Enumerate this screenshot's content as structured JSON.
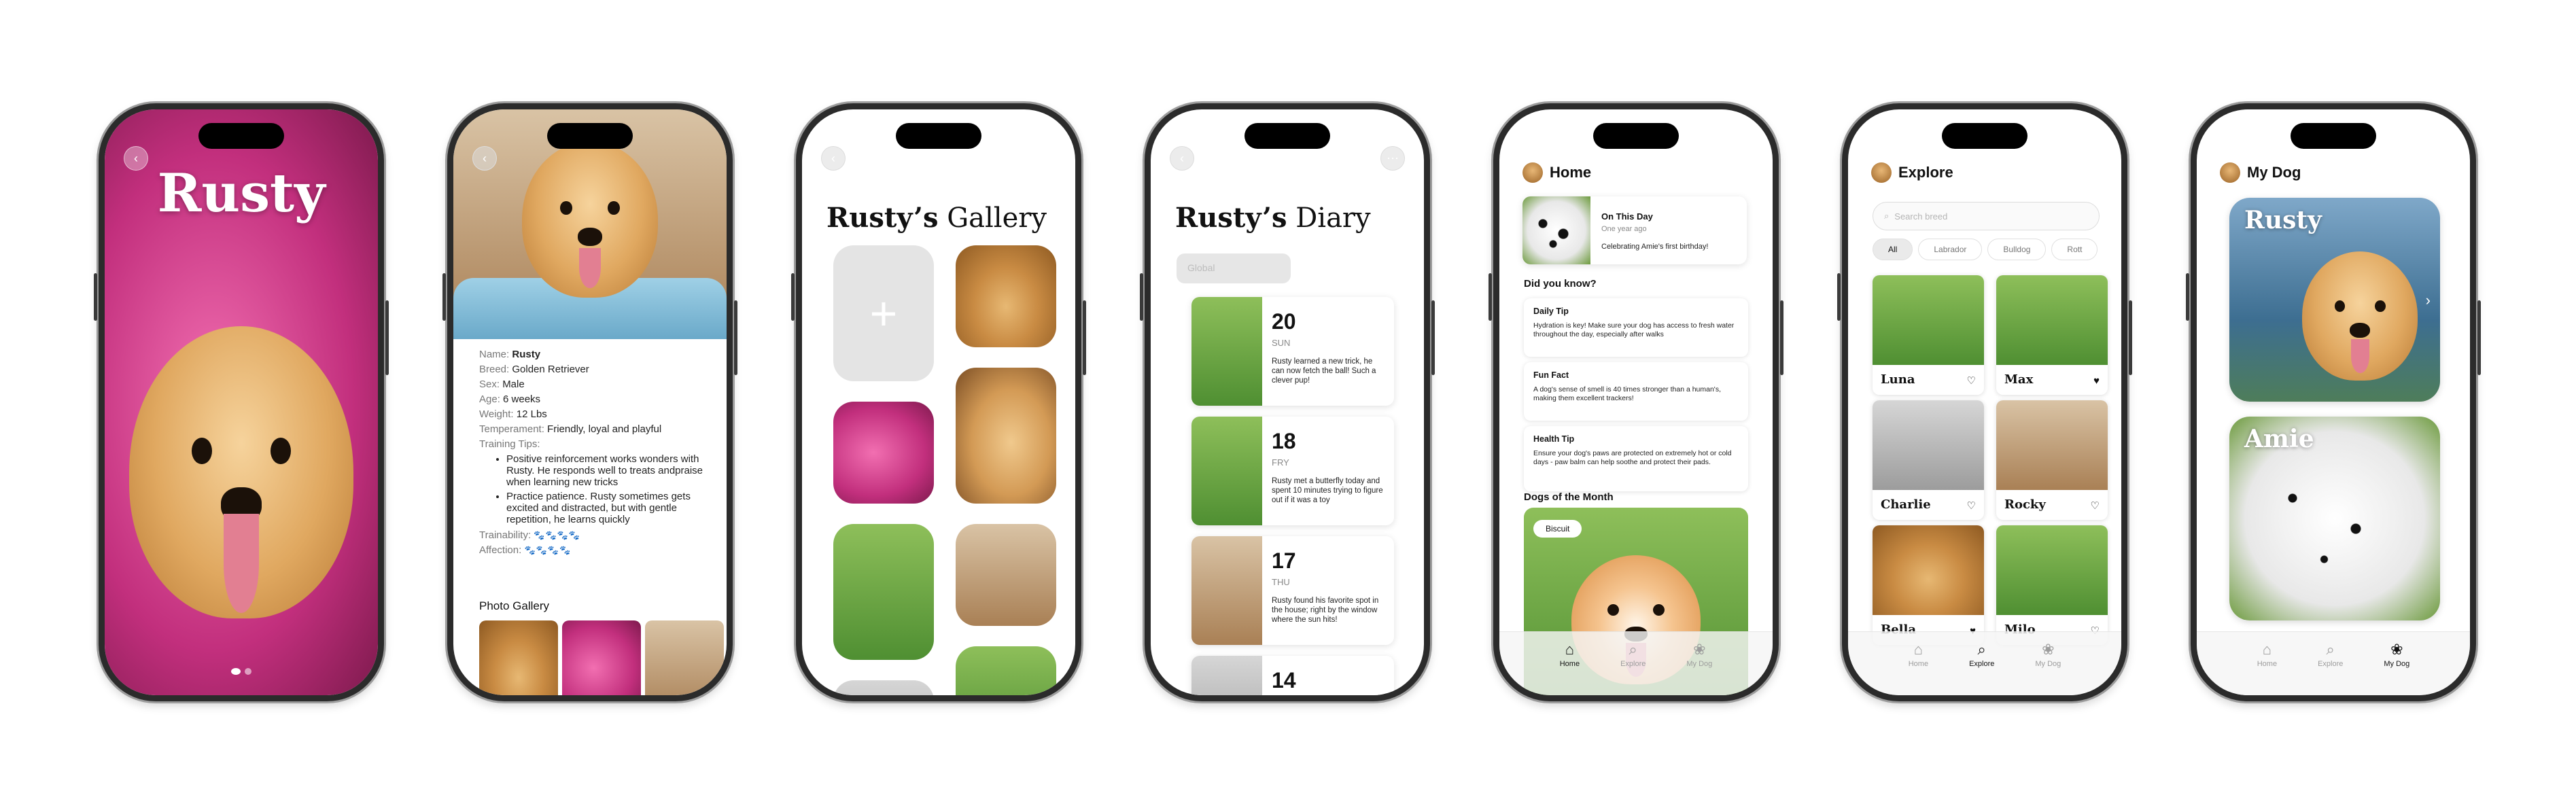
{
  "phone1": {
    "title": "Rusty",
    "back_icon": "chevron-left-icon",
    "page_dots": 2
  },
  "phone2": {
    "details": [
      {
        "key": "Name:",
        "value": "Rusty",
        "bold": true
      },
      {
        "key": "Breed:",
        "value": "Golden Retriever"
      },
      {
        "key": "Sex:",
        "value": "Male"
      },
      {
        "key": "Age:",
        "value": "6 weeks"
      },
      {
        "key": "Weight:",
        "value": "12 Lbs"
      },
      {
        "key": "Temperament:",
        "value": "Friendly, loyal and playful"
      }
    ],
    "training_label": "Training Tips:",
    "tips": [
      "Positive reinforcement works wonders with Rusty. He responds well to treats andpraise when learning new tricks",
      "Practice patience. Rusty sometimes gets excited and distracted, but with gentle repetition, he learns quickly"
    ],
    "trainability_label": "Trainability:",
    "trainability_value": "🐾🐾🐾🐾",
    "affection_label": "Affection:",
    "affection_value": "🐾🐾🐾🐾",
    "gallery_label": "Photo Gallery"
  },
  "phone3": {
    "title_bold": "Rusty’s",
    "title_rest": " Gallery",
    "add_label": "+"
  },
  "phone4": {
    "title_bold": "Rusty’s",
    "title_rest": " Diary",
    "filter_placeholder": "Global",
    "entries": [
      {
        "day": "20",
        "weekday": "SUN",
        "text": "Rusty learned a new trick, he can now fetch the ball! Such a clever pup!"
      },
      {
        "day": "18",
        "weekday": "FRY",
        "text": "Rusty met a butterfly today and spent 10 minutes trying to figure out if it was a toy"
      },
      {
        "day": "17",
        "weekday": "THU",
        "text": "Rusty found his favorite spot in the house; right by the window where the sun hits!"
      },
      {
        "day": "14",
        "weekday": "",
        "text": ""
      }
    ]
  },
  "phone5": {
    "title": "Home",
    "on_this_day": {
      "title": "On This Day",
      "sub": "One year ago",
      "text": "Celebrating Amie's first birthday!"
    },
    "did_you_know": "Did you know?",
    "tips": [
      {
        "title": "Daily Tip",
        "body": "Hydration is key! Make sure your dog has access to fresh water throughout the day, especially after walks"
      },
      {
        "title": "Fun Fact",
        "body": "A dog's sense of smell is 40 times stronger than a human's, making them excellent trackers!"
      },
      {
        "title": "Health Tip",
        "body": "Ensure your dog's paws are protected on extremely hot or cold days - paw balm can help soothe and protect their pads."
      }
    ],
    "dogs_of_month": "Dogs of the Month",
    "featured_name": "Biscuit"
  },
  "phone6": {
    "title": "Explore",
    "search_placeholder": "Search breed",
    "chips": [
      "All",
      "Labrador",
      "Bulldog",
      "Rott"
    ],
    "dogs": [
      {
        "name": "Luna",
        "liked": false
      },
      {
        "name": "Max",
        "liked": true
      },
      {
        "name": "Charlie",
        "liked": false
      },
      {
        "name": "Rocky",
        "liked": false
      },
      {
        "name": "Bella",
        "liked": true
      },
      {
        "name": "Milo",
        "liked": false
      }
    ]
  },
  "phone7": {
    "title": "My Dog",
    "dogs": [
      "Rusty",
      "Amie"
    ]
  },
  "tabbar": {
    "home": "Home",
    "explore": "Explore",
    "mydog": "My Dog"
  }
}
